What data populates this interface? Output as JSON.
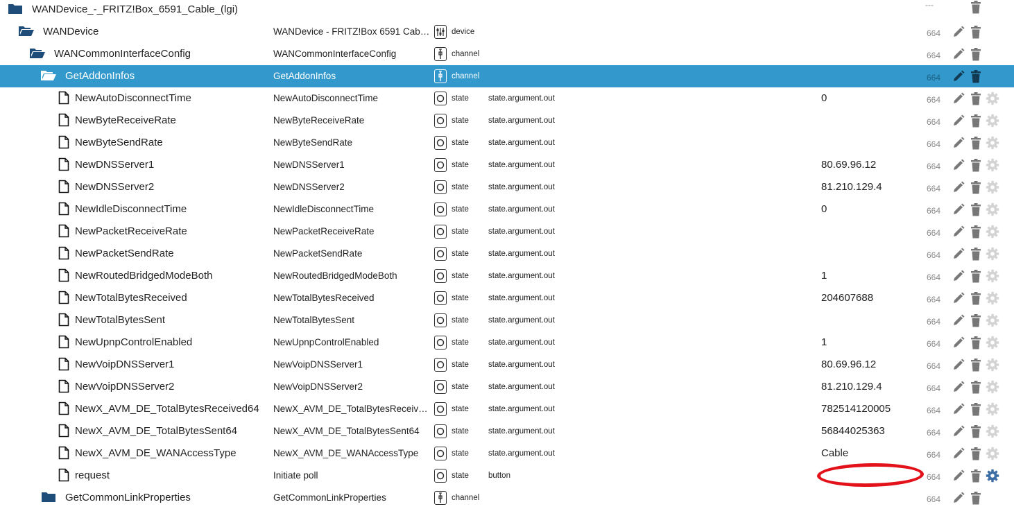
{
  "colors": {
    "selected_bg": "#3399cc",
    "icon_gray": "#777777",
    "icon_dark": "#111111",
    "folder_blue": "#1e4d7a",
    "acl_gray": "#888888",
    "highlight_red": "#e2111a"
  },
  "rows": [
    {
      "kind": "folder",
      "level": 0,
      "name": "WANDevice_-_FRITZ!Box_6591_Cable_(lgi)",
      "cname": "",
      "type": "",
      "type_icon": "",
      "role": "",
      "value": "",
      "acl": "---",
      "edit": false,
      "del": true,
      "cog": false,
      "selected": false
    },
    {
      "kind": "folder-open",
      "level": 1,
      "name": "WANDevice",
      "cname": "WANDevice - FRITZ!Box 6591 Cabl…",
      "type": "device",
      "type_icon": "device-icon",
      "role": "",
      "value": "",
      "acl": "664",
      "edit": true,
      "del": true,
      "cog": false,
      "selected": false
    },
    {
      "kind": "folder-open",
      "level": 2,
      "name": "WANCommonInterfaceConfig",
      "cname": "WANCommonInterfaceConfig",
      "type": "channel",
      "type_icon": "channel-icon",
      "role": "",
      "value": "",
      "acl": "664",
      "edit": true,
      "del": true,
      "cog": false,
      "selected": false
    },
    {
      "kind": "folder-open",
      "level": 3,
      "name": "GetAddonInfos",
      "cname": "GetAddonInfos",
      "type": "channel",
      "type_icon": "channel-icon",
      "role": "",
      "value": "",
      "acl": "664",
      "edit": true,
      "del": true,
      "cog": false,
      "selected": true
    },
    {
      "kind": "file",
      "level": 4,
      "name": "NewAutoDisconnectTime",
      "cname": "NewAutoDisconnectTime",
      "type": "state",
      "type_icon": "state-icon",
      "role": "state.argument.out",
      "value": "0",
      "acl": "664",
      "edit": true,
      "del": true,
      "cog": true,
      "selected": false
    },
    {
      "kind": "file",
      "level": 4,
      "name": "NewByteReceiveRate",
      "cname": "NewByteReceiveRate",
      "type": "state",
      "type_icon": "state-icon",
      "role": "state.argument.out",
      "value": "",
      "acl": "664",
      "edit": true,
      "del": true,
      "cog": true,
      "selected": false
    },
    {
      "kind": "file",
      "level": 4,
      "name": "NewByteSendRate",
      "cname": "NewByteSendRate",
      "type": "state",
      "type_icon": "state-icon",
      "role": "state.argument.out",
      "value": "",
      "acl": "664",
      "edit": true,
      "del": true,
      "cog": true,
      "selected": false
    },
    {
      "kind": "file",
      "level": 4,
      "name": "NewDNSServer1",
      "cname": "NewDNSServer1",
      "type": "state",
      "type_icon": "state-icon",
      "role": "state.argument.out",
      "value": "80.69.96.12",
      "acl": "664",
      "edit": true,
      "del": true,
      "cog": true,
      "selected": false
    },
    {
      "kind": "file",
      "level": 4,
      "name": "NewDNSServer2",
      "cname": "NewDNSServer2",
      "type": "state",
      "type_icon": "state-icon",
      "role": "state.argument.out",
      "value": "81.210.129.4",
      "acl": "664",
      "edit": true,
      "del": true,
      "cog": true,
      "selected": false
    },
    {
      "kind": "file",
      "level": 4,
      "name": "NewIdleDisconnectTime",
      "cname": "NewIdleDisconnectTime",
      "type": "state",
      "type_icon": "state-icon",
      "role": "state.argument.out",
      "value": "0",
      "acl": "664",
      "edit": true,
      "del": true,
      "cog": true,
      "selected": false
    },
    {
      "kind": "file",
      "level": 4,
      "name": "NewPacketReceiveRate",
      "cname": "NewPacketReceiveRate",
      "type": "state",
      "type_icon": "state-icon",
      "role": "state.argument.out",
      "value": "",
      "acl": "664",
      "edit": true,
      "del": true,
      "cog": true,
      "selected": false
    },
    {
      "kind": "file",
      "level": 4,
      "name": "NewPacketSendRate",
      "cname": "NewPacketSendRate",
      "type": "state",
      "type_icon": "state-icon",
      "role": "state.argument.out",
      "value": "",
      "acl": "664",
      "edit": true,
      "del": true,
      "cog": true,
      "selected": false
    },
    {
      "kind": "file",
      "level": 4,
      "name": "NewRoutedBridgedModeBoth",
      "cname": "NewRoutedBridgedModeBoth",
      "type": "state",
      "type_icon": "state-icon",
      "role": "state.argument.out",
      "value": "1",
      "acl": "664",
      "edit": true,
      "del": true,
      "cog": true,
      "selected": false
    },
    {
      "kind": "file",
      "level": 4,
      "name": "NewTotalBytesReceived",
      "cname": "NewTotalBytesReceived",
      "type": "state",
      "type_icon": "state-icon",
      "role": "state.argument.out",
      "value": "204607688",
      "acl": "664",
      "edit": true,
      "del": true,
      "cog": true,
      "selected": false
    },
    {
      "kind": "file",
      "level": 4,
      "name": "NewTotalBytesSent",
      "cname": "NewTotalBytesSent",
      "type": "state",
      "type_icon": "state-icon",
      "role": "state.argument.out",
      "value": "",
      "acl": "664",
      "edit": true,
      "del": true,
      "cog": true,
      "selected": false
    },
    {
      "kind": "file",
      "level": 4,
      "name": "NewUpnpControlEnabled",
      "cname": "NewUpnpControlEnabled",
      "type": "state",
      "type_icon": "state-icon",
      "role": "state.argument.out",
      "value": "1",
      "acl": "664",
      "edit": true,
      "del": true,
      "cog": true,
      "selected": false
    },
    {
      "kind": "file",
      "level": 4,
      "name": "NewVoipDNSServer1",
      "cname": "NewVoipDNSServer1",
      "type": "state",
      "type_icon": "state-icon",
      "role": "state.argument.out",
      "value": "80.69.96.12",
      "acl": "664",
      "edit": true,
      "del": true,
      "cog": true,
      "selected": false
    },
    {
      "kind": "file",
      "level": 4,
      "name": "NewVoipDNSServer2",
      "cname": "NewVoipDNSServer2",
      "type": "state",
      "type_icon": "state-icon",
      "role": "state.argument.out",
      "value": "81.210.129.4",
      "acl": "664",
      "edit": true,
      "del": true,
      "cog": true,
      "selected": false
    },
    {
      "kind": "file",
      "level": 4,
      "name": "NewX_AVM_DE_TotalBytesReceived64",
      "cname": "NewX_AVM_DE_TotalBytesReceived…",
      "type": "state",
      "type_icon": "state-icon",
      "role": "state.argument.out",
      "value": "782514120005",
      "acl": "664",
      "edit": true,
      "del": true,
      "cog": true,
      "selected": false
    },
    {
      "kind": "file",
      "level": 4,
      "name": "NewX_AVM_DE_TotalBytesSent64",
      "cname": "NewX_AVM_DE_TotalBytesSent64",
      "type": "state",
      "type_icon": "state-icon",
      "role": "state.argument.out",
      "value": "56844025363",
      "acl": "664",
      "edit": true,
      "del": true,
      "cog": true,
      "selected": false
    },
    {
      "kind": "file",
      "level": 4,
      "name": "NewX_AVM_DE_WANAccessType",
      "cname": "NewX_AVM_DE_WANAccessType",
      "type": "state",
      "type_icon": "state-icon",
      "role": "state.argument.out",
      "value": "Cable",
      "acl": "664",
      "edit": true,
      "del": true,
      "cog": true,
      "selected": false
    },
    {
      "kind": "file",
      "level": 4,
      "name": "request",
      "cname": "Initiate poll",
      "type": "state",
      "type_icon": "state-icon",
      "role": "button",
      "value": "",
      "acl": "664",
      "edit": true,
      "del": true,
      "cog": true,
      "cog_active": true,
      "selected": false
    },
    {
      "kind": "folder",
      "level": 3,
      "name": "GetCommonLinkProperties",
      "cname": "GetCommonLinkProperties",
      "type": "channel",
      "type_icon": "channel-icon",
      "role": "",
      "value": "",
      "acl": "664",
      "edit": true,
      "del": true,
      "cog": false,
      "selected": false
    }
  ]
}
